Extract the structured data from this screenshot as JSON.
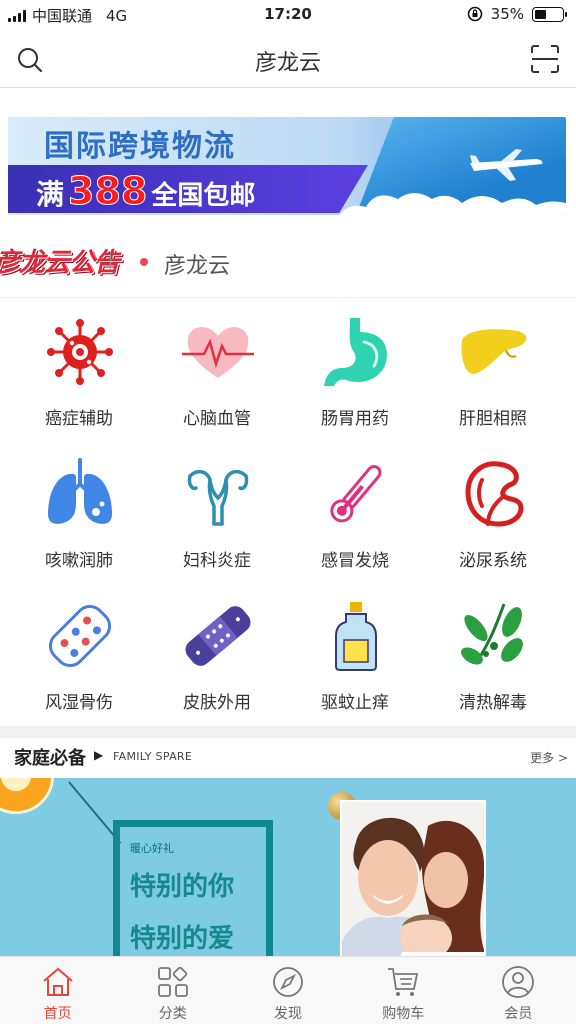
{
  "status_bar": {
    "carrier": "中国联通",
    "network": "4G",
    "time": "17:20",
    "battery": "35%",
    "battery_level": 0.35
  },
  "header": {
    "title": "彦龙云",
    "search_icon": "search-icon",
    "scan_icon": "scan-icon"
  },
  "banner": {
    "title": "国际跨境物流",
    "promo_prefix": "满",
    "promo_number": "388",
    "promo_suffix": "全国包邮"
  },
  "notice": {
    "logo_text": "彦龙云公告",
    "text": "彦龙云"
  },
  "categories": [
    {
      "label": "癌症辅助",
      "icon": "virus-icon",
      "color": "#e02020"
    },
    {
      "label": "心脑血管",
      "icon": "heart-icon",
      "color": "#f59aa4"
    },
    {
      "label": "肠胃用药",
      "icon": "stomach-icon",
      "color": "#2fd3b0"
    },
    {
      "label": "肝胆相照",
      "icon": "liver-icon",
      "color": "#f2cf1d"
    },
    {
      "label": "咳嗽润肺",
      "icon": "lungs-icon",
      "color": "#3f86e6"
    },
    {
      "label": "妇科炎症",
      "icon": "uterus-icon",
      "color": "#2f8fb0"
    },
    {
      "label": "感冒发烧",
      "icon": "thermometer-icon",
      "color": "#e03080"
    },
    {
      "label": "泌尿系统",
      "icon": "kidney-icon",
      "color": "#d42020"
    },
    {
      "label": "风湿骨伤",
      "icon": "pills-icon",
      "color": "#4a7fe0"
    },
    {
      "label": "皮肤外用",
      "icon": "bandage-icon",
      "color": "#4b3f9c"
    },
    {
      "label": "驱蚊止痒",
      "icon": "spray-bottle-icon",
      "color": "#f0b400"
    },
    {
      "label": "清热解毒",
      "icon": "herb-icon",
      "color": "#2aa040"
    }
  ],
  "family": {
    "title": "家庭必备",
    "arrow": "▶",
    "subtitle": "FAMILY SPARE",
    "more": "更多 >",
    "banner_caption": "暖心好礼",
    "banner_line1": "特别的你",
    "banner_line2": "特别的爱"
  },
  "tabbar": [
    {
      "label": "首页",
      "icon": "home-icon",
      "active": true
    },
    {
      "label": "分类",
      "icon": "category-icon",
      "active": false
    },
    {
      "label": "发现",
      "icon": "compass-icon",
      "active": false
    },
    {
      "label": "购物车",
      "icon": "cart-icon",
      "active": false
    },
    {
      "label": "会员",
      "icon": "user-icon",
      "active": false
    }
  ],
  "colors": {
    "accent": "#e8453c",
    "notice_red": "#e0283a"
  }
}
